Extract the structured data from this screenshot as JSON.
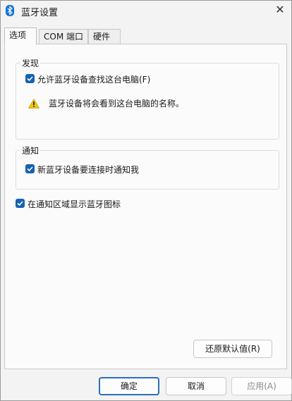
{
  "window": {
    "title": "蓝牙设置",
    "close_glyph": "✕"
  },
  "tabs": [
    {
      "label": "选项",
      "active": true
    },
    {
      "label": "COM 端口",
      "active": false
    },
    {
      "label": "硬件",
      "active": false
    }
  ],
  "discovery": {
    "legend": "发现",
    "allow_discovery_label": "允许蓝牙设备查找这台电脑(F)",
    "allow_discovery_checked": true,
    "warning_text": "蓝牙设备将会看到这台电脑的名称。",
    "warning_icon": "warning-triangle-icon"
  },
  "notifications": {
    "legend": "通知",
    "notify_label": "新蓝牙设备要连接时通知我",
    "notify_checked": true
  },
  "show_tray_icon": {
    "label": "在通知区域显示蓝牙图标",
    "checked": true
  },
  "buttons": {
    "restore_defaults": "还原默认值(R)",
    "ok": "确定",
    "cancel": "取消",
    "apply": "应用(A)"
  },
  "colors": {
    "accent": "#1562b0",
    "warning": "#f2c500"
  }
}
